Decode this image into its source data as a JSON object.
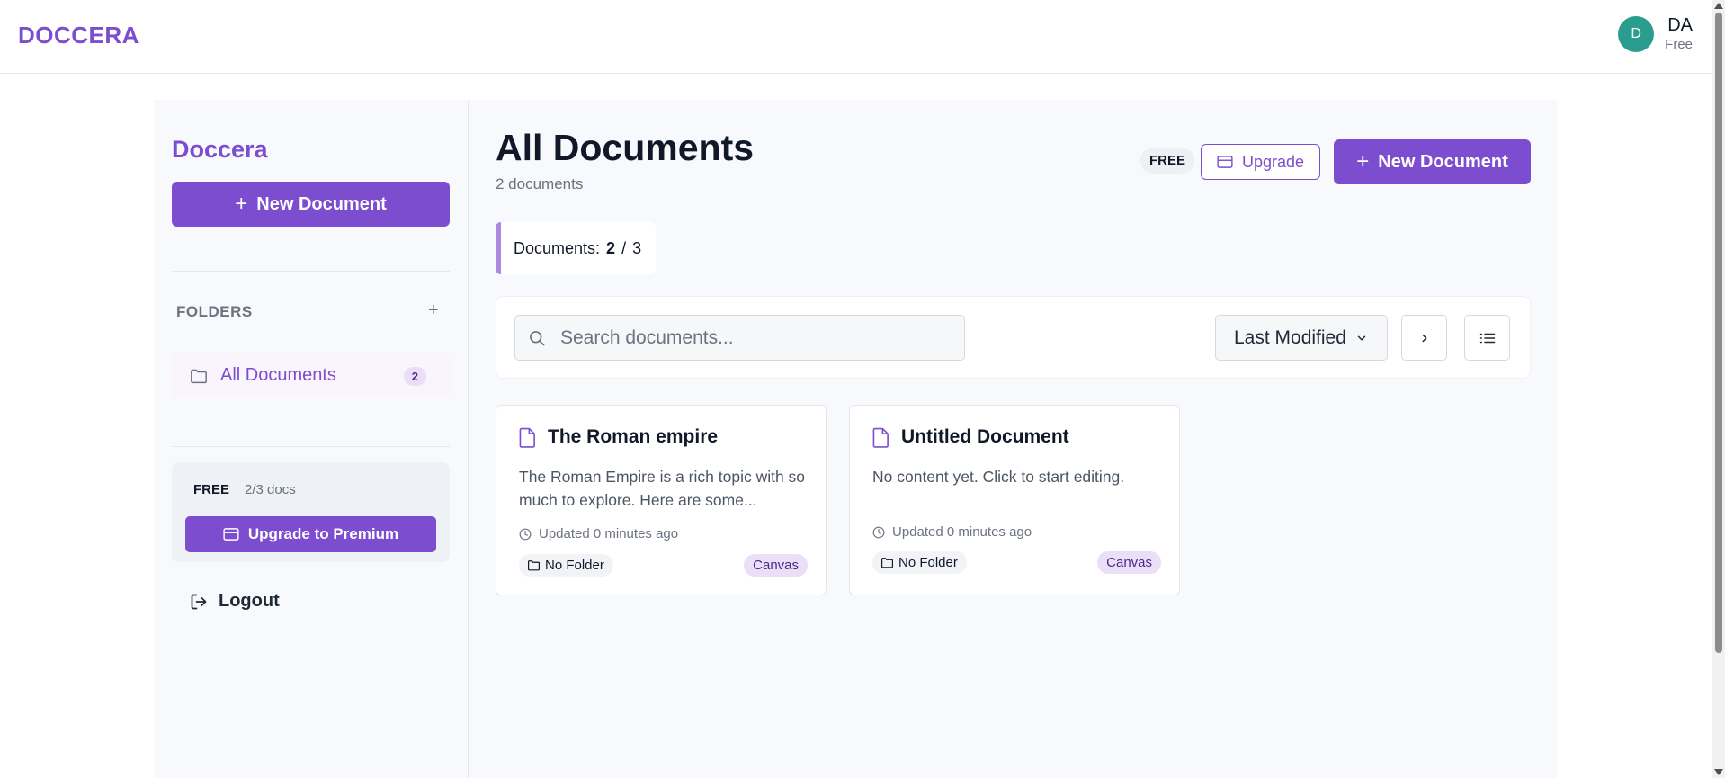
{
  "header": {
    "brand": "DOCCERA",
    "avatar_letter": "D",
    "user_initials": "DA",
    "user_plan": "Free"
  },
  "sidebar": {
    "brand": "Doccera",
    "new_document_label": "New Document",
    "folders_heading": "FOLDERS",
    "folders_add": "+",
    "folders": [
      {
        "name": "All Documents",
        "count": "2"
      }
    ],
    "plan": {
      "tier": "FREE",
      "usage": "2/3 docs",
      "upgrade_label": "Upgrade to Premium"
    },
    "logout_label": "Logout"
  },
  "main": {
    "title": "All Documents",
    "subtitle": "2 documents",
    "plan_badge": "FREE",
    "upgrade_label": "Upgrade",
    "new_document_label": "New Document",
    "quota": {
      "label": "Documents:",
      "used": "2",
      "separator": "/",
      "limit": "3"
    },
    "search": {
      "placeholder": "Search documents...",
      "value": ""
    },
    "sort": {
      "selected": "Last Modified"
    }
  },
  "documents": [
    {
      "title": "The Roman empire",
      "preview": "The Roman Empire is a rich topic with so much to explore. Here are some...",
      "updated": "Updated 0 minutes ago",
      "folder": "No Folder",
      "type": "Canvas"
    },
    {
      "title": "Untitled Document",
      "preview": "No content yet. Click to start editing.",
      "updated": "Updated 0 minutes ago",
      "folder": "No Folder",
      "type": "Canvas"
    }
  ],
  "colors": {
    "accent": "#7c4dce",
    "avatar": "#2a9d8f",
    "tag_bg": "#ebdff7",
    "panel_bg": "#f7f9fc"
  }
}
